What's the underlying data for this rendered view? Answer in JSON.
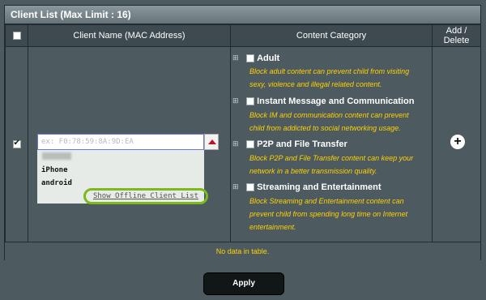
{
  "header": {
    "title": "Client List (Max Limit : 16)"
  },
  "table": {
    "columns": [
      "",
      "Client Name (MAC Address)",
      "Content Category",
      "Add / Delete"
    ],
    "row_checked": true,
    "client_input_value": "ex: F0:78:59:8A:9D:EA",
    "client_dropdown_items": [
      "iPhone",
      "android"
    ],
    "offline_link": "Show Offline Client List",
    "categories": [
      {
        "title": "Adult",
        "desc1": "Block adult content can prevent child from visiting",
        "desc2": "sexy, violence and illegal related content."
      },
      {
        "title": "Instant Message and Communication",
        "desc1": "Block IM and communication content can prevent",
        "desc2": "child from addicted to social networking usage."
      },
      {
        "title": "P2P and File Transfer",
        "desc1": "Block P2P and File Transfer content can keep your",
        "desc2": "network in a better transmission quality."
      },
      {
        "title": "Streaming and Entertainment",
        "desc1": "Block Streaming and Entertainment content can",
        "desc2": "prevent child from spending long time on Internet",
        "desc3": "entertainment."
      }
    ],
    "add_icon": "plus-circle-icon",
    "no_data": "No data in table."
  },
  "apply_label": "Apply"
}
